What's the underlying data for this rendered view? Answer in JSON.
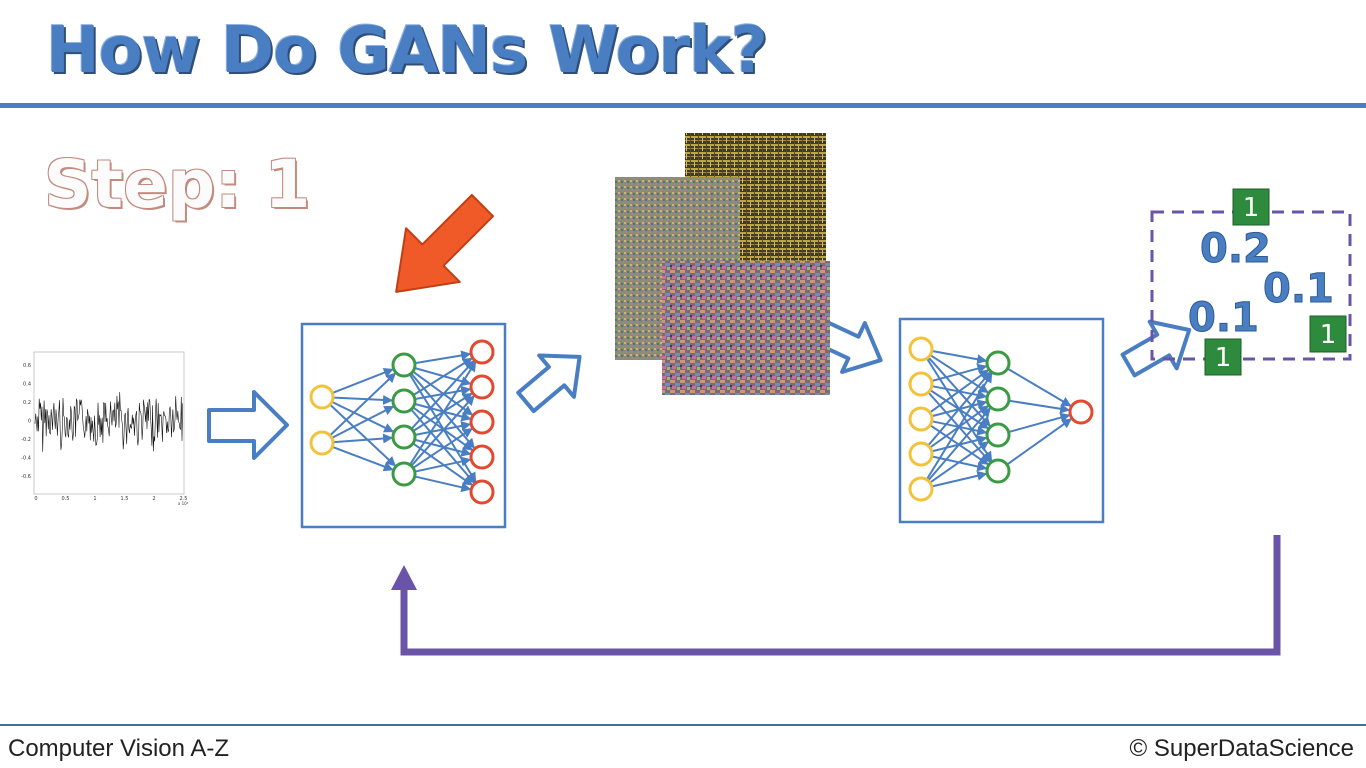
{
  "slide": {
    "title": "How Do GANs Work?",
    "step_label": "Step: 1",
    "footer_left": "Computer Vision A-Z",
    "footer_right": "© SuperDataScience"
  },
  "noise_plot": {
    "y_ticks": [
      "0.6",
      "0.4",
      "0.2",
      "0",
      "-0.2",
      "-0.4",
      "-0.6"
    ],
    "x_ticks": [
      "0",
      "0.5",
      "1",
      "1.5",
      "2",
      "2.5"
    ],
    "x_multiplier": "x 10⁴"
  },
  "discriminator_outputs": {
    "values": [
      "0.2",
      "0.1",
      "0.1"
    ],
    "labels": [
      "1",
      "1",
      "1"
    ]
  },
  "colors": {
    "accent_blue": "#4a7ec2",
    "arrow_orange": "#ef5a28",
    "feedback_purple": "#6a54a8",
    "label_green": "#2e8b3e",
    "input_node": "#f2c33a",
    "hidden_node": "#3b9a44",
    "output_node": "#e2492f"
  }
}
